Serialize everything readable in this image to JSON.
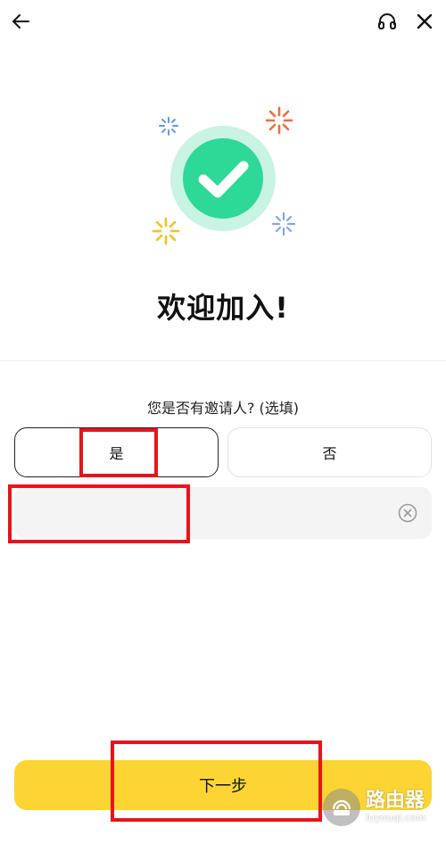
{
  "header": {
    "back_icon": "arrow-left-icon",
    "support_icon": "headset-icon",
    "close_icon": "close-icon"
  },
  "hero": {
    "icon": "check-circle-icon",
    "title": "欢迎加入!"
  },
  "referral": {
    "question": "您是否有邀请人? (选填)",
    "yes_label": "是",
    "no_label": "否",
    "selected": "是",
    "input_value": "",
    "input_placeholder": "",
    "clear_icon": "clear-circle-icon"
  },
  "footer": {
    "next_label": "下一步"
  },
  "watermark": {
    "title": "路由器",
    "subtitle": "luyouqi.com"
  },
  "colors": {
    "accent": "#fcd535",
    "success": "#2ed897",
    "success_halo": "#c9f3e2",
    "highlight": "#e8141b"
  }
}
